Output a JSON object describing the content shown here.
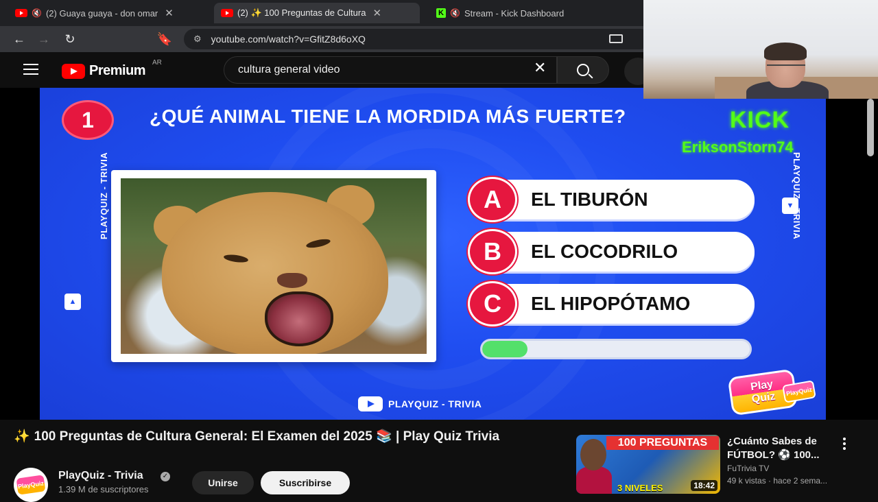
{
  "browser": {
    "tabs": [
      {
        "label": "(2) Guaya guaya - don omar",
        "favicon": "youtube-icon",
        "muted": true
      },
      {
        "label": "(2) ✨ 100 Preguntas de Cultura",
        "favicon": "youtube-icon",
        "active": true
      },
      {
        "label": "Stream - Kick Dashboard",
        "favicon": "kick-icon",
        "muted": true
      }
    ],
    "url": "youtube.com/watch?v=GfitZ8d6oXQ"
  },
  "youtube": {
    "logo_text": "Premium",
    "region": "AR",
    "search_value": "cultura general video"
  },
  "video": {
    "question_number": "1",
    "question": "¿QUÉ ANIMAL TIENE LA MORDIDA MÁS FUERTE?",
    "overlay_kick": "KICK",
    "overlay_user": "EriksonStorn74",
    "side_label": "PLAYQUIZ - TRIVIA",
    "answers": [
      {
        "letter": "A",
        "text": "EL TIBURÓN"
      },
      {
        "letter": "B",
        "text": "EL COCODRILO"
      },
      {
        "letter": "C",
        "text": "EL HIPOPÓTAMO"
      }
    ],
    "timer_progress": 0.17,
    "logo_line1": "Play",
    "logo_line2": "Quiz",
    "bottom_brand": "PLAYQUIZ - TRIVIA",
    "accent_color": "#e6173f",
    "bg_color": "#1f4df0"
  },
  "details": {
    "title": "100 Preguntas de Cultura General: El Examen del 2025 📚 | Play Quiz Trivia",
    "title_prefix": "✨",
    "channel": "PlayQuiz - Trivia",
    "subscribers": "1.39 M de suscriptores",
    "join_label": "Unirse",
    "subscribe_label": "Suscribirse"
  },
  "recommendation": {
    "thumb_banner": "100 PREGUNTAS",
    "thumb_sub": "3 NIVELES",
    "duration": "18:42",
    "title": "¿Cuánto Sabes de FÚTBOL? ⚽ 100...",
    "channel": "FuTrivia TV",
    "meta": "49 k vistas · hace 2 sema..."
  }
}
